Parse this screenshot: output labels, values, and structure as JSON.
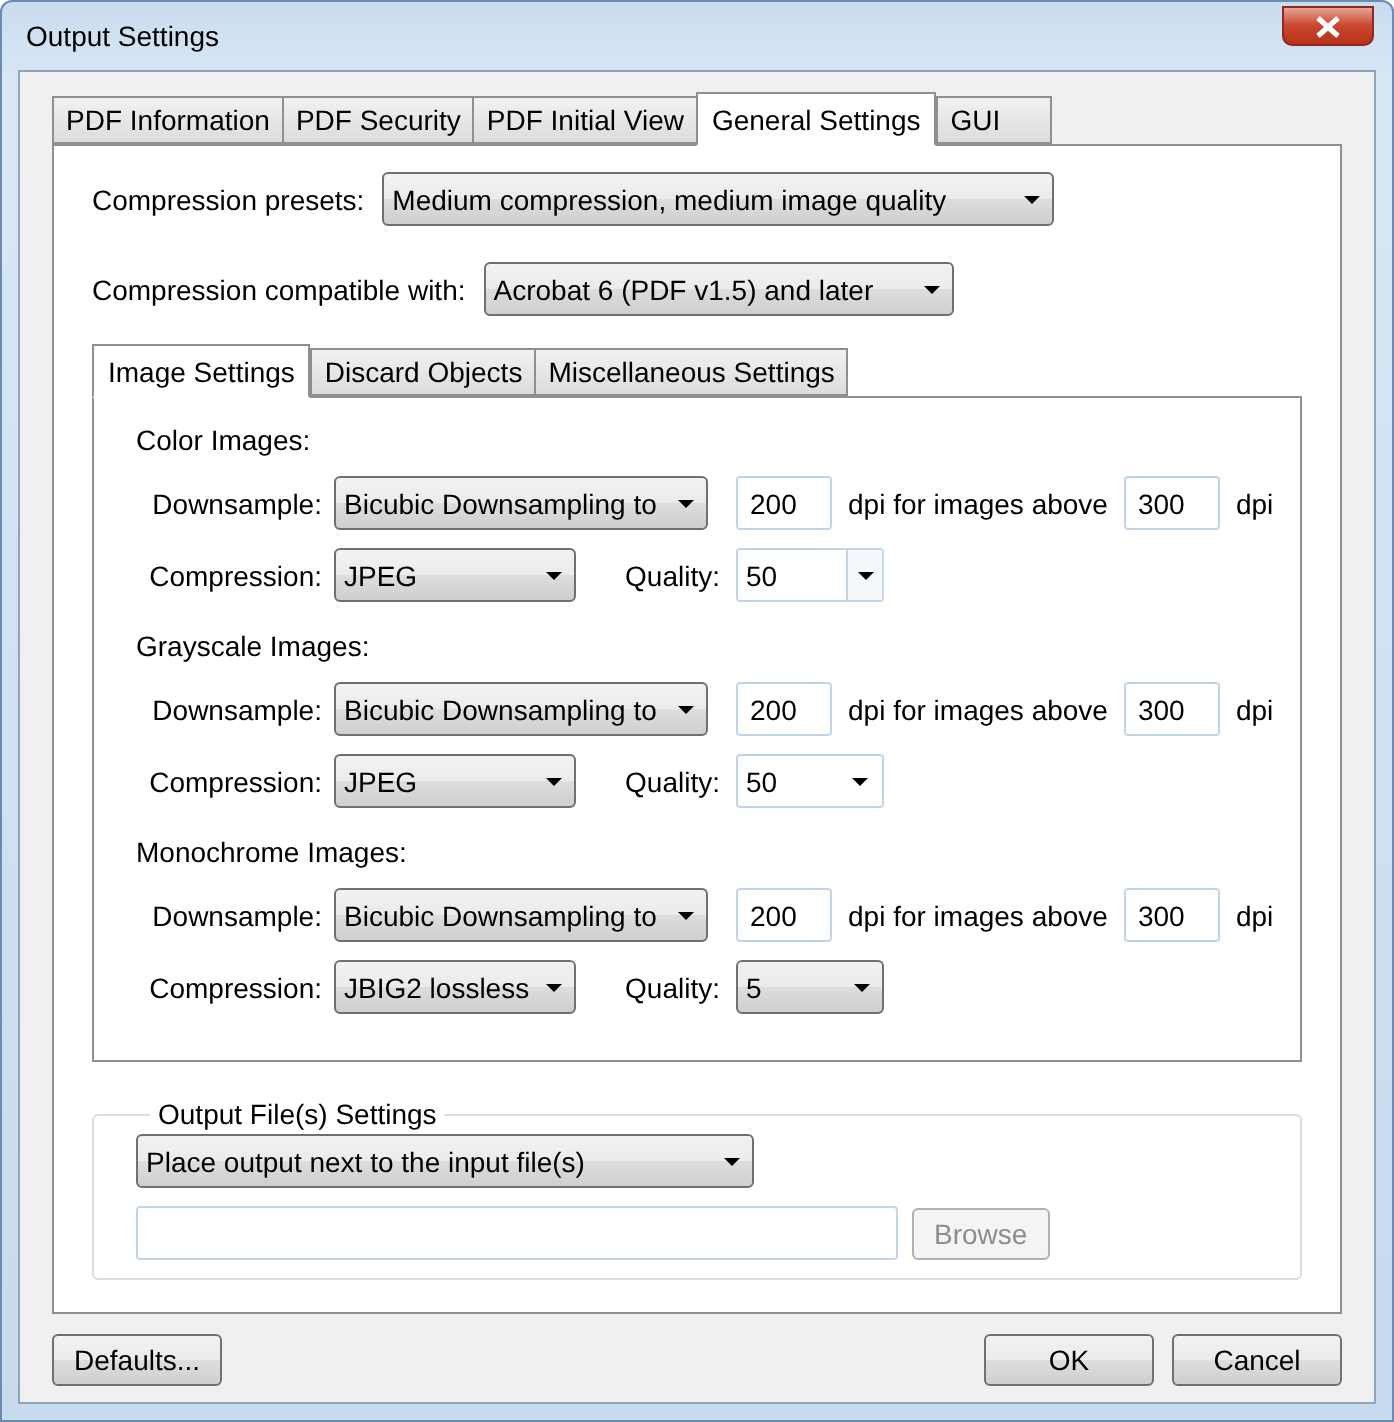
{
  "window": {
    "title": "Output Settings"
  },
  "tabs": [
    {
      "label": "PDF Information",
      "selected": false
    },
    {
      "label": "PDF Security",
      "selected": false
    },
    {
      "label": "PDF Initial View",
      "selected": false
    },
    {
      "label": "General Settings",
      "selected": true
    },
    {
      "label": "GUI",
      "selected": false
    }
  ],
  "presets": {
    "label": "Compression presets:",
    "value": "Medium compression, medium image quality"
  },
  "compatible": {
    "label": "Compression compatible with:",
    "value": "Acrobat 6 (PDF v1.5) and later"
  },
  "image_tabs": [
    {
      "label": "Image Settings",
      "selected": true
    },
    {
      "label": "Discard Objects",
      "selected": false
    },
    {
      "label": "Miscellaneous Settings",
      "selected": false
    }
  ],
  "sections": [
    {
      "title": "Color Images:",
      "downsample": {
        "label": "Downsample:",
        "method": "Bicubic Downsampling to",
        "resolution": "200",
        "middle": "dpi for images above",
        "threshold": "300",
        "unit": "dpi"
      },
      "compression": {
        "label": "Compression:",
        "value": "JPEG"
      },
      "quality": {
        "label": "Quality:",
        "value": "50",
        "kind": "editable"
      }
    },
    {
      "title": "Grayscale Images:",
      "downsample": {
        "label": "Downsample:",
        "method": "Bicubic Downsampling to",
        "resolution": "200",
        "middle": "dpi for images above",
        "threshold": "300",
        "unit": "dpi"
      },
      "compression": {
        "label": "Compression:",
        "value": "JPEG"
      },
      "quality": {
        "label": "Quality:",
        "value": "50",
        "kind": "plain"
      }
    },
    {
      "title": "Monochrome Images:",
      "downsample": {
        "label": "Downsample:",
        "method": "Bicubic Downsampling to",
        "resolution": "200",
        "middle": "dpi for images above",
        "threshold": "300",
        "unit": "dpi"
      },
      "compression": {
        "label": "Compression:",
        "value": "JBIG2 lossless"
      },
      "quality": {
        "label": "Quality:",
        "value": "5",
        "kind": "button"
      }
    }
  ],
  "output": {
    "legend": "Output File(s) Settings",
    "location": "Place output next to the input file(s)",
    "browse": {
      "label": "Browse",
      "disabled": true
    }
  },
  "footer": {
    "left_buttons": [
      "Defaults..."
    ],
    "right_buttons": [
      "OK",
      "Cancel"
    ]
  }
}
